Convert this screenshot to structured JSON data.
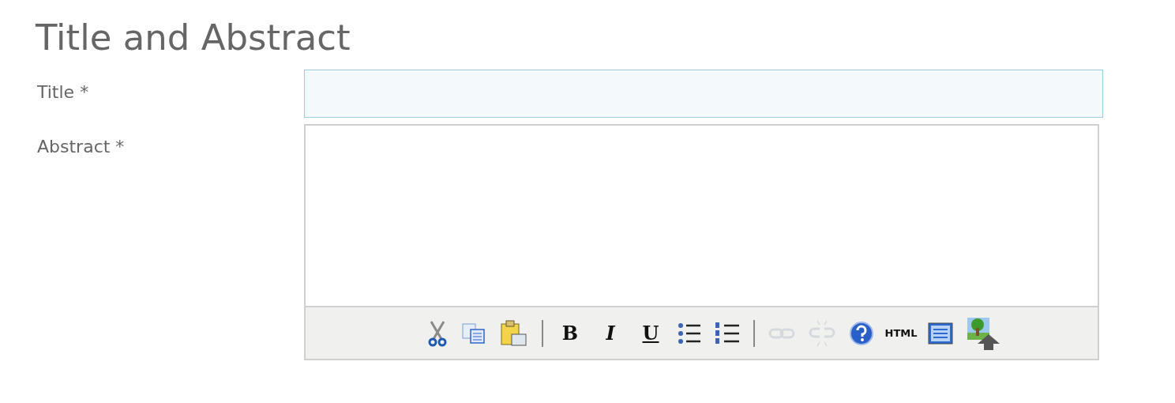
{
  "heading": "Title and Abstract",
  "fields": [
    {
      "label": "Title *",
      "kind": "input"
    },
    {
      "label": "Abstract *",
      "kind": "editor"
    }
  ],
  "toolbar": [
    {
      "kind": "cut",
      "disabled": false
    },
    {
      "kind": "copy",
      "disabled": false
    },
    {
      "kind": "paste",
      "disabled": false
    },
    {
      "kind": "separator"
    },
    {
      "kind": "bold",
      "text": "B",
      "disabled": false
    },
    {
      "kind": "italic",
      "text": "I",
      "disabled": false
    },
    {
      "kind": "underline",
      "text": "U",
      "disabled": false
    },
    {
      "kind": "bullets",
      "disabled": false
    },
    {
      "kind": "numbers",
      "disabled": false
    },
    {
      "kind": "separator"
    },
    {
      "kind": "link",
      "disabled": true
    },
    {
      "kind": "unlink",
      "disabled": true
    },
    {
      "kind": "help",
      "disabled": false
    },
    {
      "kind": "html",
      "text": "HTML",
      "disabled": false
    },
    {
      "kind": "window",
      "disabled": false
    },
    {
      "kind": "image",
      "disabled": false
    }
  ]
}
